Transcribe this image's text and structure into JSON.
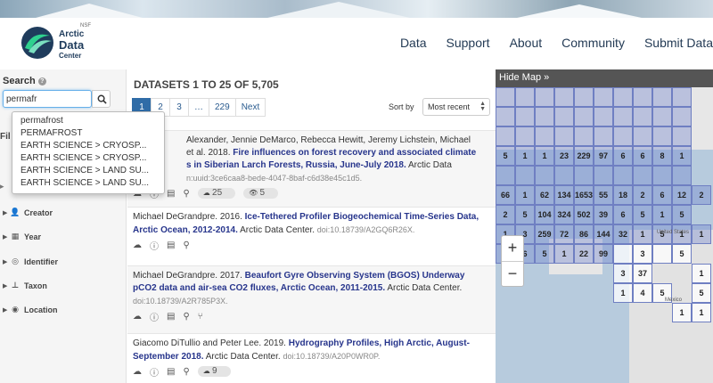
{
  "header": {
    "logo": {
      "nsf": "NSF",
      "line1": "Arctic",
      "line2": "Data",
      "line3": "Center"
    },
    "nav": [
      "Data",
      "Support",
      "About",
      "Community",
      "Submit Data"
    ]
  },
  "sidebar": {
    "search_label": "Search",
    "search_value": "permafr",
    "filter_partial": "Fil",
    "filter_partial2": "▸",
    "filters": [
      {
        "label": "Creator",
        "icon": "user-icon"
      },
      {
        "label": "Year",
        "icon": "calendar-icon"
      },
      {
        "label": "Identifier",
        "icon": "target-icon"
      },
      {
        "label": "Taxon",
        "icon": "sitemap-icon"
      },
      {
        "label": "Location",
        "icon": "globe-icon"
      }
    ]
  },
  "autocomplete": [
    "permafrost",
    "PERMAFROST",
    "EARTH SCIENCE > CRYOSP...",
    "EARTH SCIENCE > CRYOSP...",
    "EARTH SCIENCE > LAND SU...",
    "EARTH SCIENCE > LAND SU..."
  ],
  "results_header": {
    "title": "DATASETS 1 TO 25 OF 5,705",
    "pages": [
      "1",
      "2",
      "3",
      "…",
      "229",
      "Next"
    ],
    "sort_label": "Sort by",
    "sort_value": "Most recent"
  },
  "results": [
    {
      "authors": "Alexander, Jennie DeMarco, Rebecca Hewitt, Jeremy Lichstein, Michael",
      "year_prefix": "et al. 2018.",
      "title": "Fire influences on forest recovery and associated climate",
      "title2": "s in Siberian Larch Forests, Russia, June-July 2018.",
      "center": "Arctic Data",
      "doi": "n:uuid:3ce6caa8-bede-4047-8baf-c6d38e45c1d5.",
      "downloads": "25",
      "views": "5"
    },
    {
      "authors": "Michael DeGrandpre. 2016.",
      "title": "Ice-Tethered Profiler Biogeochemical Time-Series Data, Arctic Ocean, 2012-2014.",
      "center": "Arctic Data Center.",
      "doi": "doi:10.18739/A2GQ6R26X."
    },
    {
      "authors": "Michael DeGrandpre. 2017.",
      "title": "Beaufort Gyre Observing System (BGOS) Underway pCO2 data and air-sea CO2 fluxes, Arctic Ocean, 2011-2015.",
      "center": "Arctic Data Center.",
      "doi": "doi:10.18739/A2R785P3X."
    },
    {
      "authors": "Giacomo DiTullio and Peter Lee. 2019.",
      "title": "Hydrography Profiles, High Arctic, August-September 2018.",
      "center": "Arctic Data Center.",
      "doi": "doi:10.18739/A20P0WR0P.",
      "downloads": "9"
    }
  ],
  "map": {
    "hide_label": "Hide Map",
    "hide_arrow": "»",
    "zoom_in": "+",
    "zoom_out": "−",
    "labels": [
      "United States",
      "Mexico"
    ],
    "cells": [
      [
        "",
        "",
        "",
        "",
        "",
        "",
        "",
        "",
        "",
        ""
      ],
      [
        "",
        "",
        "",
        "",
        "",
        "",
        "",
        "",
        "",
        ""
      ],
      [
        "",
        "",
        "",
        "",
        "",
        "",
        "",
        "",
        "",
        ""
      ],
      [
        "5",
        "1",
        "1",
        "23",
        "229",
        "97",
        "6",
        "6",
        "8",
        "1"
      ],
      [
        "",
        "",
        "",
        "",
        "",
        "",
        "",
        "",
        "",
        ""
      ],
      [
        "66",
        "1",
        "62",
        "134",
        "1653",
        "55",
        "18",
        "2",
        "6",
        "12",
        "2"
      ],
      [
        "2",
        "5",
        "104",
        "324",
        "502",
        "39",
        "6",
        "5",
        "1",
        "5"
      ],
      [
        "1",
        "3",
        "259",
        "72",
        "86",
        "144",
        "32",
        "1",
        "5",
        "1",
        "1"
      ],
      [
        "",
        "6",
        "5",
        "1",
        "22",
        "99",
        "",
        "3",
        "",
        "5"
      ]
    ],
    "lower": [
      "3",
      "37",
      "4",
      "5",
      "1",
      "1",
      "5",
      "1",
      "1"
    ]
  }
}
